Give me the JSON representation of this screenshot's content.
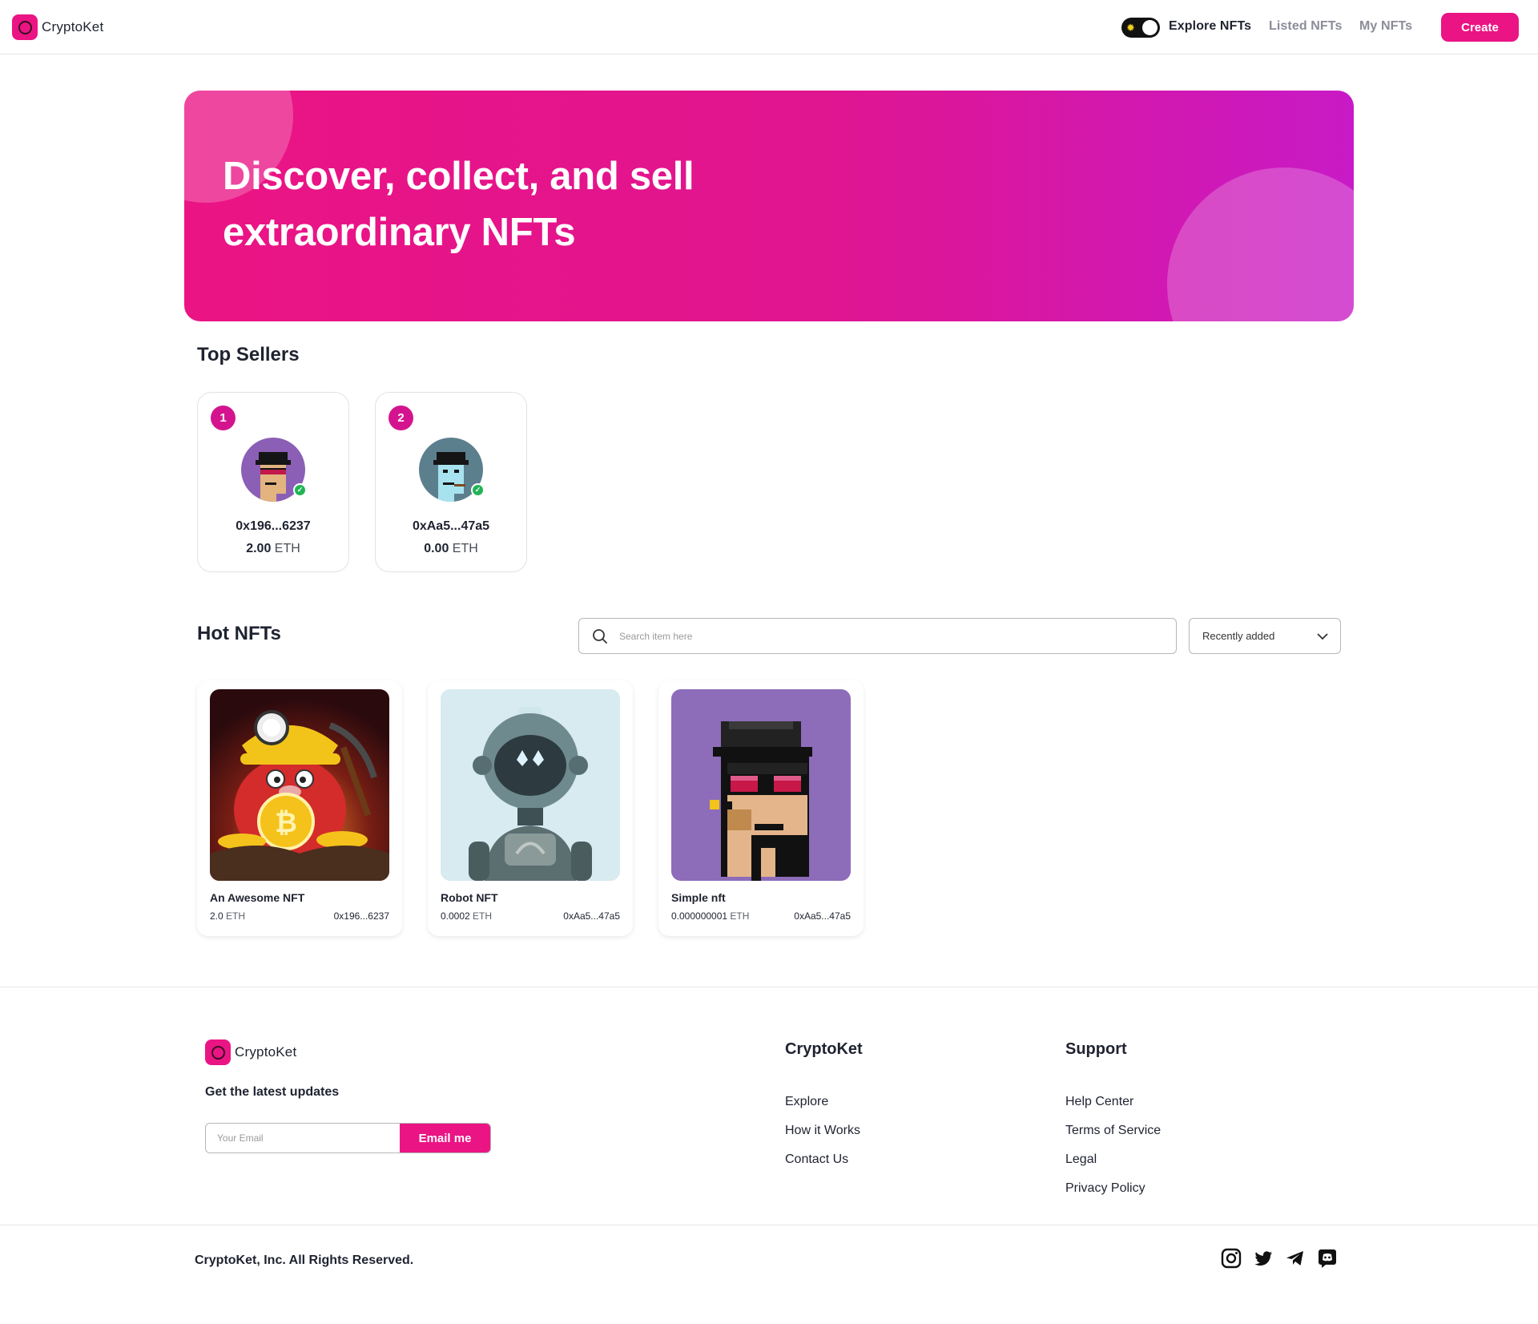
{
  "navbar": {
    "brand": "CryptoKet",
    "links": [
      "Explore NFTs",
      "Listed NFTs",
      "My NFTs"
    ],
    "active_link": "Explore NFTs",
    "create_label": "Create"
  },
  "hero": {
    "title_line1": "Discover, collect, and sell",
    "title_line2": "extraordinary NFTs"
  },
  "top_sellers": {
    "title": "Top Sellers",
    "sellers": [
      {
        "rank": "1",
        "address": "0x196...6237",
        "amount": "2.00",
        "unit": "ETH"
      },
      {
        "rank": "2",
        "address": "0xAa5...47a5",
        "amount": "0.00",
        "unit": "ETH"
      }
    ]
  },
  "hot_nfts": {
    "title": "Hot NFTs",
    "search_placeholder": "Search item here",
    "sort_selected": "Recently added",
    "items": [
      {
        "name": "An Awesome NFT",
        "price": "2.0",
        "unit": "ETH",
        "owner": "0x196...6237"
      },
      {
        "name": "Robot NFT",
        "price": "0.0002",
        "unit": "ETH",
        "owner": "0xAa5...47a5"
      },
      {
        "name": "Simple nft",
        "price": "0.000000001",
        "unit": "ETH",
        "owner": "0xAa5...47a5"
      }
    ]
  },
  "footer": {
    "brand": "CryptoKet",
    "tagline": "Get the latest updates",
    "email_placeholder": "Your Email",
    "email_button": "Email me",
    "col1": {
      "title": "CryptoKet",
      "links": [
        "Explore",
        "How it Works",
        "Contact Us"
      ]
    },
    "col2": {
      "title": "Support",
      "links": [
        "Help Center",
        "Terms of Service",
        "Legal",
        "Privacy Policy"
      ]
    },
    "copyright": "CryptoKet, Inc. All Rights Reserved.",
    "social_icons": [
      "instagram-icon",
      "twitter-icon",
      "telegram-icon",
      "discord-icon"
    ]
  },
  "colors": {
    "accent": "#eb1484",
    "hero_gradient_end": "#c81ac6",
    "verified": "#22b455"
  }
}
